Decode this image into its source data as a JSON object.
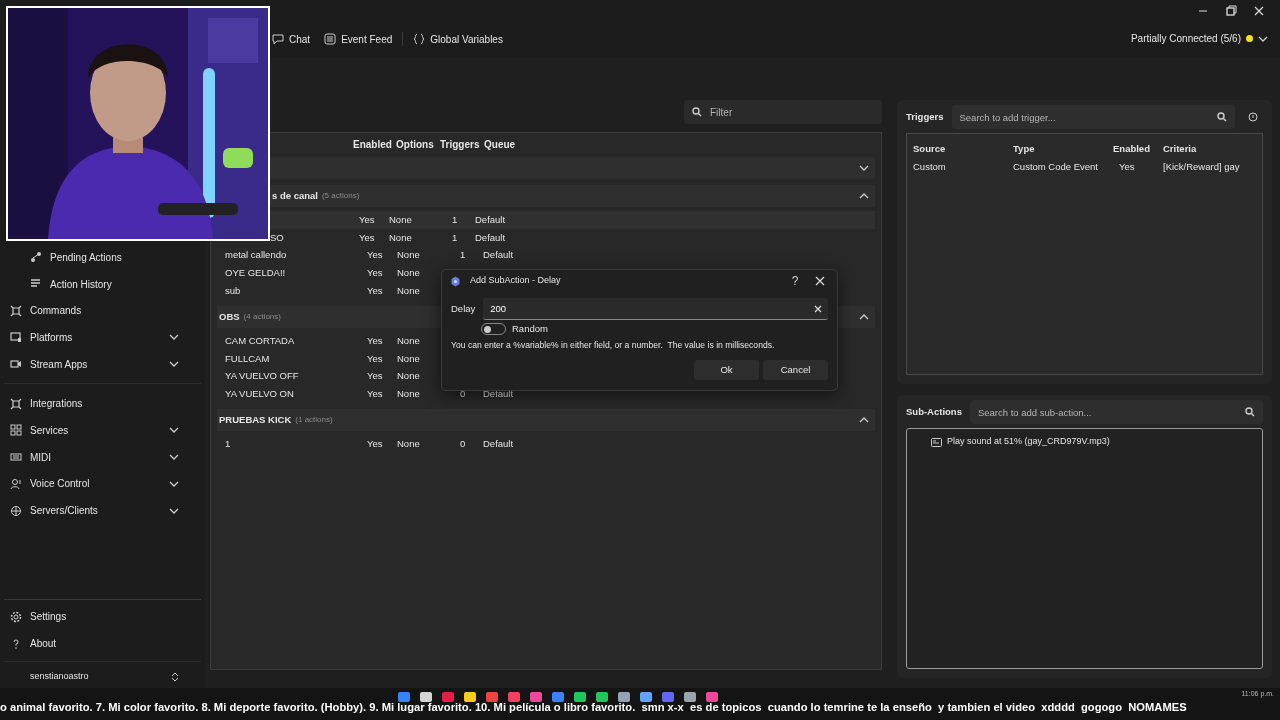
{
  "tabs": [
    {
      "label": "Chat"
    },
    {
      "label": "Event Feed"
    },
    {
      "label": "Global Variables"
    }
  ],
  "connection": {
    "label": "Partially Connected (5/6)",
    "color": "#f5e21b"
  },
  "sidebar": {
    "items": [
      {
        "label": "Pending Actions",
        "indent": true
      },
      {
        "label": "Action History",
        "indent": true
      },
      {
        "label": "Commands"
      },
      {
        "label": "Platforms",
        "expandable": true
      },
      {
        "label": "Stream Apps",
        "expandable": true,
        "divider_after": true
      },
      {
        "label": "Integrations"
      },
      {
        "label": "Services",
        "expandable": true
      },
      {
        "label": "MIDI",
        "expandable": true
      },
      {
        "label": "Voice Control",
        "expandable": true
      },
      {
        "label": "Servers/Clients",
        "expandable": true
      }
    ],
    "footer": [
      {
        "label": "Settings"
      },
      {
        "label": "About"
      }
    ],
    "user": "senstianoastro"
  },
  "filter": {
    "placeholder": "Filter"
  },
  "actions": {
    "columns": [
      "Enabled",
      "Options",
      "Triggers",
      "Queue"
    ],
    "groups": [
      {
        "expanded": false
      },
      {
        "name": "s de canal",
        "count": "(5 actions)",
        "expanded": true,
        "rows": [
          {
            "enabled": "Yes",
            "options": "None",
            "triggers": "1",
            "queue": "Default",
            "selected": true
          },
          {
            "name": "SO",
            "enabled": "Yes",
            "options": "None",
            "triggers": "1",
            "queue": "Default",
            "selected": false
          },
          {
            "name": "metal callendo",
            "enabled": "Yes",
            "options": "None",
            "triggers": "1",
            "queue": "Default",
            "selected": false
          },
          {
            "name": "OYE GELDA!!",
            "enabled": "Yes",
            "options": "None",
            "selected": false
          },
          {
            "name": "sub",
            "enabled": "Yes",
            "options": "None",
            "selected": false
          }
        ]
      },
      {
        "name": "OBS",
        "count": "(4 actions)",
        "expanded": true,
        "rows": [
          {
            "name": "CAM CORTADA",
            "enabled": "Yes",
            "options": "None",
            "selected": false
          },
          {
            "name": "FULLCAM",
            "enabled": "Yes",
            "options": "None",
            "selected": false
          },
          {
            "name": "YA VUELVO OFF",
            "enabled": "Yes",
            "options": "None",
            "selected": false
          },
          {
            "name": "YA VUELVO ON",
            "enabled": "Yes",
            "options": "None",
            "triggers": "0",
            "queue": "Default",
            "selected": false
          }
        ]
      },
      {
        "name": "PRUEBAS KICK",
        "count": "(1 actions)",
        "expanded": true,
        "rows": [
          {
            "name": "1",
            "enabled": "Yes",
            "options": "None",
            "triggers": "0",
            "queue": "Default",
            "selected": false
          }
        ]
      }
    ]
  },
  "triggers": {
    "title": "Triggers",
    "placeholder": "Search to add trigger...",
    "columns": [
      "Source",
      "Type",
      "Enabled",
      "Criteria"
    ],
    "rows": [
      [
        "Custom",
        "Custom Code Event",
        "Yes",
        "[Kick/Reward] gay"
      ]
    ]
  },
  "sub_actions": {
    "title": "Sub-Actions",
    "placeholder": "Search to add sub-action...",
    "items": [
      "Play sound at 51% (gay_CRD979V.mp3)"
    ]
  },
  "dialog": {
    "title": "Add SubAction - Delay",
    "help": "?",
    "field_label": "Delay",
    "value": "200",
    "toggle": {
      "label": "Random",
      "on": false
    },
    "hint": "You can enter a %variable% in either field, or a number.  The value is in milliseconds.",
    "buttons": [
      "Ok",
      "Cancel"
    ]
  },
  "ticker": {
    "text": "o animal favorito. 7. Mi color favorito. 8. Mi deporte favorito. (Hobby). 9. Mi lugar favorito. 10. Mi película o libro favorito.  smn x-x  es de topicos  cuando lo temrine te la enseño  y tambien el video  xdddd  gogogo  NOMAMES",
    "time": "11:06 p.m."
  }
}
